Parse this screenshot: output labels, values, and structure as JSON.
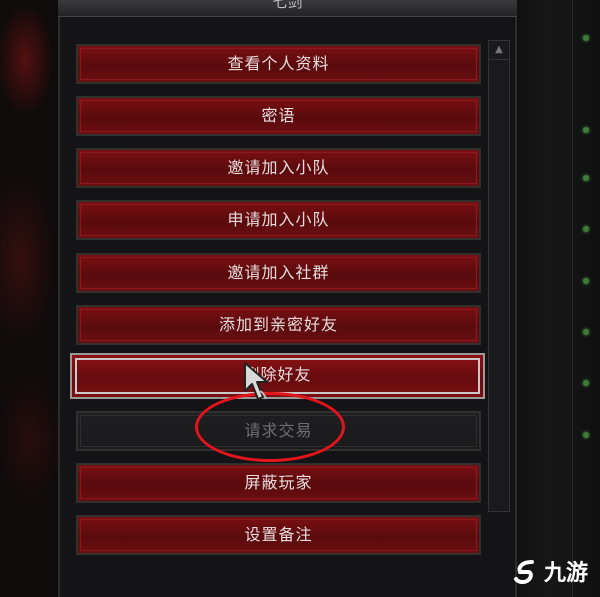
{
  "header": {
    "title": "七剑"
  },
  "menu": {
    "items": [
      {
        "label": "查看个人资料",
        "state": "normal"
      },
      {
        "label": "密语",
        "state": "normal"
      },
      {
        "label": "邀请加入小队",
        "state": "normal"
      },
      {
        "label": "申请加入小队",
        "state": "normal"
      },
      {
        "label": "邀请加入社群",
        "state": "normal"
      },
      {
        "label": "添加到亲密好友",
        "state": "normal"
      },
      {
        "label": "删除好友",
        "state": "hover"
      },
      {
        "label": "请求交易",
        "state": "disabled"
      },
      {
        "label": "屏蔽玩家",
        "state": "normal"
      },
      {
        "label": "设置备注",
        "state": "normal"
      }
    ]
  },
  "scrollbar": {
    "up_icon": "triangle-up-icon"
  },
  "annotation": {
    "color": "#e3141a",
    "shape": "ellipse",
    "target": "请求交易"
  },
  "watermark": {
    "text": "九游",
    "logo_icon": "j9-logo-icon"
  },
  "colors": {
    "button_red": "#6c0e11",
    "disabled": "#1f1f21",
    "status_green": "#3f7a37"
  }
}
